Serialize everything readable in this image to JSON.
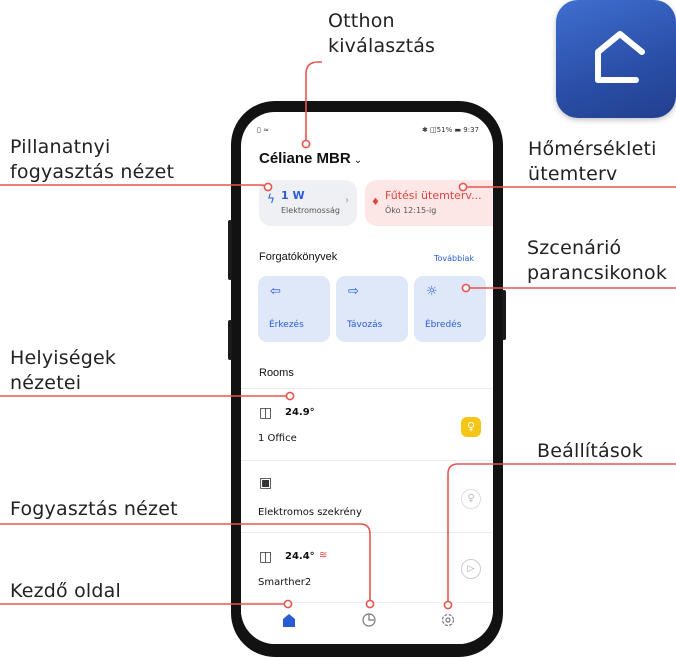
{
  "callouts": {
    "home_select": "Otthon\nkiválasztás",
    "instant_consumption": "Pillanatnyi\nfogyasztás nézet",
    "temp_schedule": "Hőmérsékleti\nütemterv",
    "scene_shortcuts": "Szcenárió\nparancsikonok",
    "room_views": "Helyiségek\nnézetei",
    "settings": "Beállítások",
    "consumption_view": "Fogyasztás nézet",
    "home_page": "Kezdő oldal"
  },
  "colors": {
    "callout_line": "#e8564e",
    "accent_blue": "#2a5bd7",
    "heating_red": "#e0443c",
    "app_icon": "#2f58b8"
  },
  "app": {
    "status_left": "▯ ≈",
    "status_right": "✱ ◫51% ▬ 9:37",
    "home_name": "Céliane MBR",
    "home_chevron": "⌄",
    "power_value": "1 W",
    "power_label": "Elektromosság",
    "heating_title": "Fűtési ütemterv...",
    "heating_sub": "Öko 12:15-ig",
    "scenarios_title": "Forgatókönyvek",
    "scenarios_more": "Továbbiak",
    "scenes": [
      {
        "label": "Érkezés",
        "icon": "arrive-icon"
      },
      {
        "label": "Távozás",
        "icon": "leave-icon"
      },
      {
        "label": "Ébredés",
        "icon": "sun-icon"
      }
    ],
    "rooms_title": "Rooms",
    "rooms": [
      {
        "name": "1 Office",
        "temp": "24.9°",
        "icon": "door-icon",
        "action_icon": "bulb-icon"
      },
      {
        "name": "Elektromos szekrény",
        "temp": "",
        "icon": "panel-icon",
        "action_icon": "bulb-icon"
      },
      {
        "name": "Smarther2",
        "temp": "24.4°",
        "icon": "door-icon",
        "action_icon": "play-icon"
      }
    ],
    "tabs": [
      "home-icon",
      "consumption-icon",
      "settings-icon"
    ]
  }
}
